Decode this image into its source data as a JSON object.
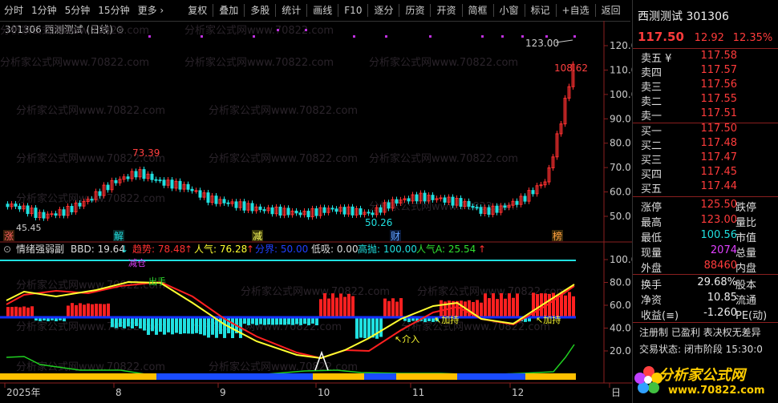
{
  "toolbar": {
    "left": [
      "分时",
      "1分钟",
      "5分钟",
      "15分钟",
      "更多 ›"
    ],
    "right": [
      "复权",
      "叠加",
      "多股",
      "统计",
      "画线",
      "F10",
      "逐分",
      "历资",
      "开资",
      "简框",
      "小窗",
      "标记",
      "+自选",
      "返回"
    ]
  },
  "stock": {
    "title": "301306 西测测试 (日线)",
    "name": "西测测试",
    "code": "301306",
    "price": "117.50",
    "change": "12.92",
    "pct": "12.35%"
  },
  "price_axis": [
    "120.0",
    "110.0",
    "100.0",
    "90.0",
    "80.0",
    "70.0",
    "60.0",
    "50.0"
  ],
  "indicator_axis": [
    "100.0",
    "80.0",
    "60.0",
    "40.0",
    "20.0"
  ],
  "annotations": {
    "high_label": "73.39",
    "low_label": "50.26",
    "left_label": "45.45",
    "peak_label": "123.00",
    "last_label": "108.62"
  },
  "markers": {
    "m1": "涨",
    "m2": "解",
    "m3": "减",
    "m4": "财",
    "m5": "榜"
  },
  "indicator": {
    "name": "情绪强弱副",
    "bbd": "BBD: 19.64",
    "trend": "趋势: 78.48",
    "pop": "人气: 76.28",
    "div": "分界: 50.00",
    "low": "低吸: 0.00",
    "high": "高抛: 100.00",
    "popA": "人气A: 25.54",
    "sig_jianchang": "减仓",
    "sig_chushou": "出手",
    "sig_jieru": "介入",
    "sig_jiachi1": "加持",
    "sig_jiachi2": "加持"
  },
  "date_axis": [
    "2025年",
    "8",
    "9",
    "10",
    "11",
    "12",
    "日"
  ],
  "quote_rows": [
    {
      "label": "卖五 ¥",
      "value": "117.58"
    },
    {
      "label": "卖四",
      "value": "117.57"
    },
    {
      "label": "卖三",
      "value": "117.56"
    },
    {
      "label": "卖二",
      "value": "117.55"
    },
    {
      "label": "卖一",
      "value": "117.51"
    },
    {
      "label": "买一",
      "value": "117.50"
    },
    {
      "label": "买二",
      "value": "117.48"
    },
    {
      "label": "买三",
      "value": "117.47"
    },
    {
      "label": "买四",
      "value": "117.45"
    },
    {
      "label": "买五",
      "value": "117.44"
    }
  ],
  "stats_rows": [
    {
      "label": "涨停",
      "value": "125.50",
      "label2": "跌停",
      "color": "red"
    },
    {
      "label": "最高",
      "value": "123.00",
      "label2": "量比",
      "color": "red"
    },
    {
      "label": "最低",
      "value": "100.56",
      "label2": "市值",
      "color": "cyan"
    },
    {
      "label": "现量",
      "value": "2074",
      "label2": "总量",
      "color": "mag"
    },
    {
      "label": "外盘",
      "value": "88460",
      "label2": "内盘",
      "color": "red"
    }
  ],
  "fund_rows": [
    {
      "label": "换手",
      "value": "29.68%",
      "label2": "股本"
    },
    {
      "label": "净资",
      "value": "10.85",
      "label2": "流通"
    },
    {
      "label": "收益(≡)",
      "value": "-1.260",
      "label2": "PE(动)"
    }
  ],
  "status": {
    "line1": "注册制 已盈利 表决权无差异",
    "line2": "交易状态: 闭市阶段 15:30:0"
  },
  "logo": {
    "text": "分析家公式网",
    "url": "www.70822.com"
  },
  "watermark": "分析家公式网www.70822.com",
  "colors": {
    "up": "#ff3030",
    "down": "#20e0e0",
    "yellow": "#ffff30",
    "blue": "#1540ff"
  }
}
